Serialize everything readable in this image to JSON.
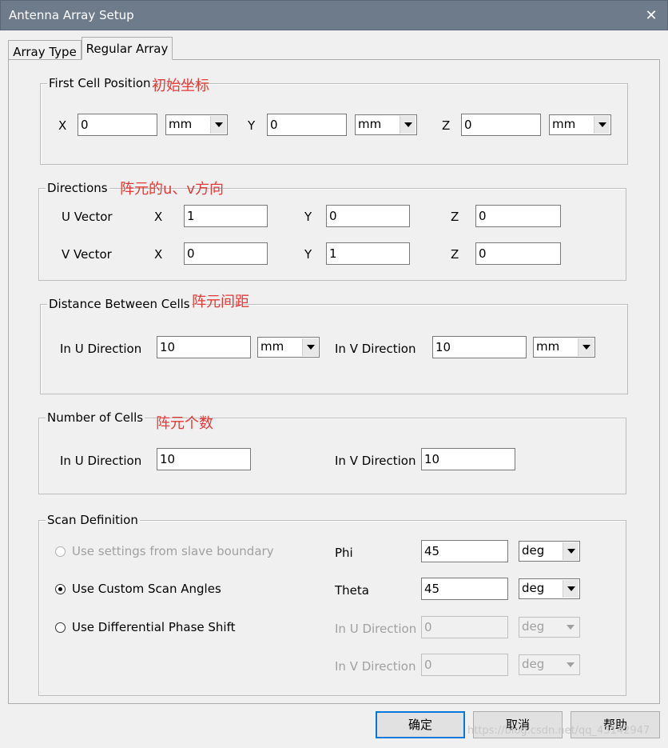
{
  "window": {
    "title": "Antenna Array Setup",
    "close": "✕"
  },
  "tabs": [
    "Array Type",
    "Regular Array"
  ],
  "first_cell": {
    "legend": "First Cell Position",
    "annotation": "初始坐标",
    "x_label": "X",
    "x_value": "0",
    "x_unit": "mm",
    "y_label": "Y",
    "y_value": "0",
    "y_unit": "mm",
    "z_label": "Z",
    "z_value": "0",
    "z_unit": "mm"
  },
  "directions": {
    "legend": "Directions",
    "annotation": "阵元的u、v方向",
    "u_label": "U Vector",
    "v_label": "V Vector",
    "x_label": "X",
    "y_label": "Y",
    "z_label": "Z",
    "u_x": "1",
    "u_y": "0",
    "u_z": "0",
    "v_x": "0",
    "v_y": "1",
    "v_z": "0"
  },
  "distance": {
    "legend": "Distance Between Cells",
    "annotation": "阵元间距",
    "u_label": "In U Direction",
    "u_value": "10",
    "u_unit": "mm",
    "v_label": "In V Direction",
    "v_value": "10",
    "v_unit": "mm"
  },
  "num_cells": {
    "legend": "Number of Cells",
    "annotation": "阵元个数",
    "u_label": "In U Direction",
    "u_value": "10",
    "v_label": "In V Direction",
    "v_value": "10"
  },
  "scan": {
    "legend": "Scan Definition",
    "opt_slave": "Use settings from slave boundary",
    "opt_custom": "Use Custom Scan Angles",
    "opt_diff": "Use Differential Phase Shift",
    "phi_label": "Phi",
    "phi_value": "45",
    "phi_unit": "deg",
    "theta_label": "Theta",
    "theta_value": "45",
    "theta_unit": "deg",
    "u_label": "In U Direction",
    "u_value": "0",
    "u_unit": "deg",
    "v_label": "In V Direction",
    "v_value": "0",
    "v_unit": "deg",
    "selected": "custom"
  },
  "buttons": {
    "ok": "确定",
    "cancel": "取消",
    "help": "帮助"
  },
  "watermark": "https://blog.csdn.net/qq_43142947"
}
